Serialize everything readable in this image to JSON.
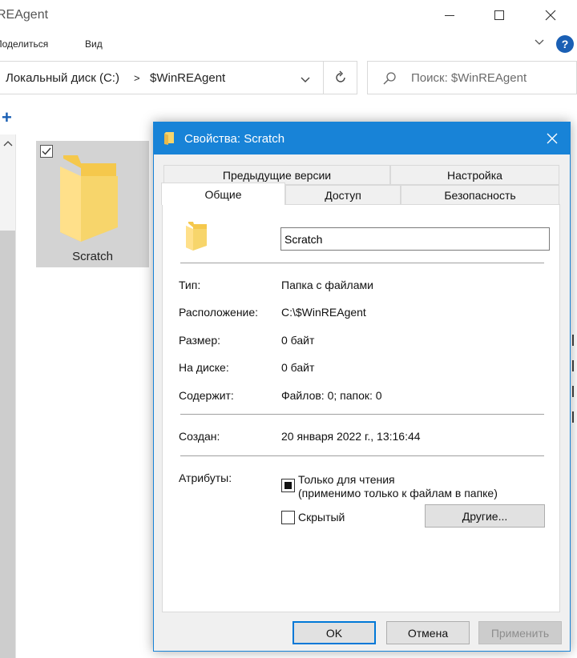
{
  "window": {
    "title": "REAgent"
  },
  "ribbon": {
    "share": "Поделиться",
    "view": "Вид",
    "help": "?"
  },
  "address": {
    "drive": "Локальный диск (C:)",
    "separator": ">",
    "folder": "$WinREAgent"
  },
  "search": {
    "placeholder": "Поиск: $WinREAgent"
  },
  "content": {
    "folder_name": "Scratch"
  },
  "dialog": {
    "title": "Свойства: Scratch",
    "tabs": {
      "previous_versions": "Предыдущие версии",
      "settings": "Настройка",
      "general": "Общие",
      "access": "Доступ",
      "security": "Безопасность"
    },
    "name_value": "Scratch",
    "rows": [
      {
        "label": "Тип:",
        "value": "Папка с файлами"
      },
      {
        "label": "Расположение:",
        "value": "C:\\$WinREAgent"
      },
      {
        "label": "Размер:",
        "value": "0 байт"
      },
      {
        "label": "На диске:",
        "value": "0 байт"
      },
      {
        "label": "Содержит:",
        "value": "Файлов: 0; папок: 0"
      }
    ],
    "created": {
      "label": "Создан:",
      "value": "20 января 2022 г., 13:16:44"
    },
    "attributes": {
      "label": "Атрибуты:",
      "readonly_line1": "Только для чтения",
      "readonly_line2": "(применимо только к файлам в папке)",
      "readonly_state": "indeterminate",
      "hidden": "Скрытый",
      "hidden_checked": false,
      "other_button": "Другие..."
    },
    "buttons": {
      "ok": "OK",
      "cancel": "Отмена",
      "apply": "Применить"
    }
  },
  "colors": {
    "accent": "#1883d7",
    "folder": "#f7d56b",
    "selection": "#d3d3d3"
  },
  "icons": [
    "folder-icon",
    "refresh-icon",
    "search-icon",
    "close-icon",
    "help-icon",
    "chevron-down-icon",
    "plus-icon"
  ]
}
